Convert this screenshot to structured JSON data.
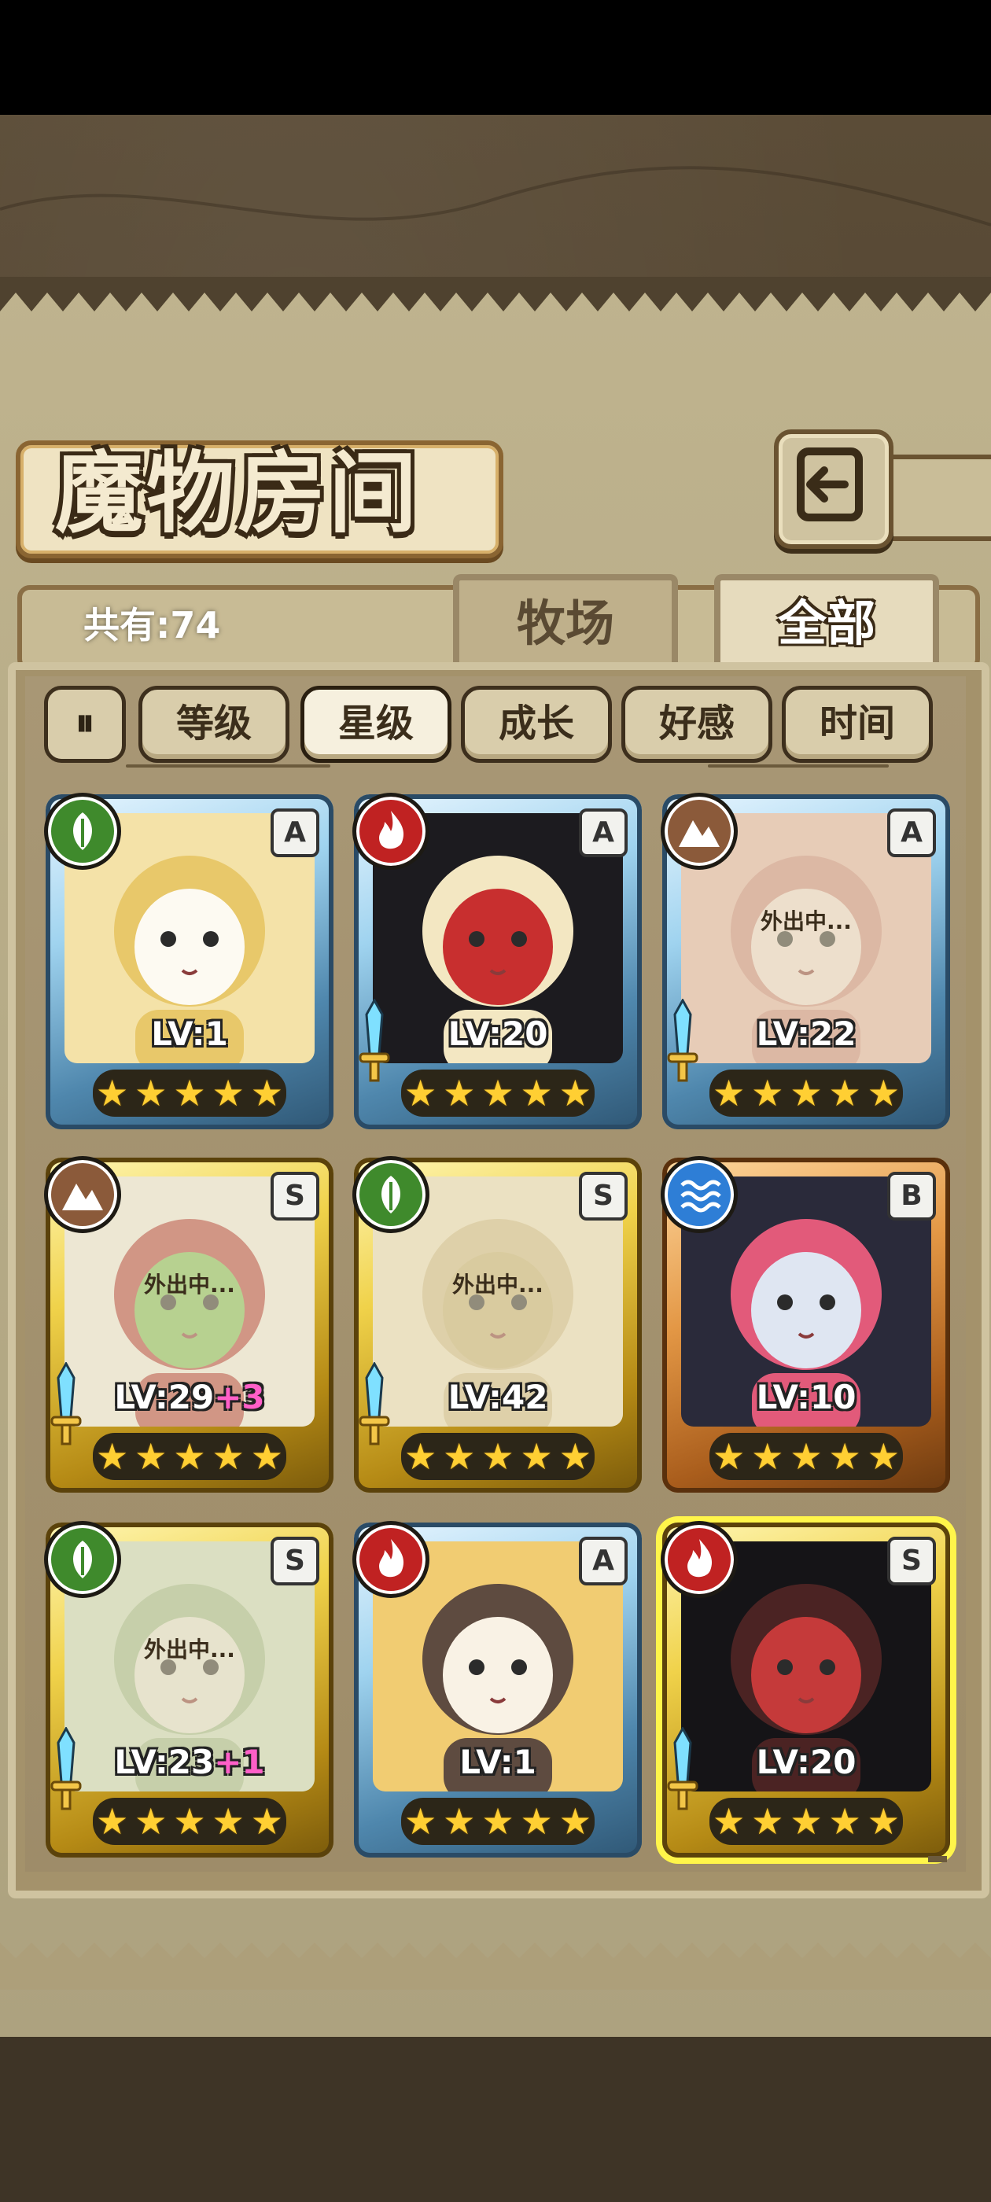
{
  "header": {
    "title": "魔物房间",
    "back_icon": "return-arrow-icon"
  },
  "tabs": {
    "count_label": "共有:74",
    "farm": "牧场",
    "all": "全部",
    "active": "all"
  },
  "sort": {
    "toggle_icon": "sort-direction-icon",
    "buttons": [
      "等级",
      "星级",
      "成长",
      "好感",
      "时间"
    ],
    "active": "星级"
  },
  "colors": {
    "nature": "#3f8a2c",
    "fire": "#c02222",
    "earth": "#8b5a3a",
    "water": "#2e7ed6",
    "level_bonus": "#ff5fc8",
    "star": "#ffcf33"
  },
  "monsters": [
    {
      "element": "nature",
      "rank": "A",
      "frame": "blue",
      "level": "LV:1",
      "bonus": "",
      "stars": 5,
      "status": "",
      "weapon": false
    },
    {
      "element": "fire",
      "rank": "A",
      "frame": "blue",
      "level": "LV:20",
      "bonus": "",
      "stars": 5,
      "status": "",
      "weapon": true
    },
    {
      "element": "earth",
      "rank": "A",
      "frame": "blue",
      "level": "LV:22",
      "bonus": "",
      "stars": 5,
      "status": "外出中...",
      "weapon": true
    },
    {
      "element": "earth",
      "rank": "S",
      "frame": "gold",
      "level": "LV:29",
      "bonus": "+3",
      "stars": 5,
      "status": "外出中...",
      "weapon": true
    },
    {
      "element": "nature",
      "rank": "S",
      "frame": "gold",
      "level": "LV:42",
      "bonus": "",
      "stars": 5,
      "status": "外出中...",
      "weapon": true
    },
    {
      "element": "water",
      "rank": "B",
      "frame": "orange",
      "level": "LV:10",
      "bonus": "",
      "stars": 5,
      "status": "",
      "weapon": false
    },
    {
      "element": "nature",
      "rank": "S",
      "frame": "gold",
      "level": "LV:23",
      "bonus": "+1",
      "stars": 5,
      "status": "外出中...",
      "weapon": true
    },
    {
      "element": "fire",
      "rank": "A",
      "frame": "blue",
      "level": "LV:1",
      "bonus": "",
      "stars": 5,
      "status": "",
      "weapon": false
    },
    {
      "element": "fire",
      "rank": "S",
      "frame": "gold",
      "level": "LV:20",
      "bonus": "",
      "stars": 5,
      "status": "",
      "weapon": true
    }
  ]
}
